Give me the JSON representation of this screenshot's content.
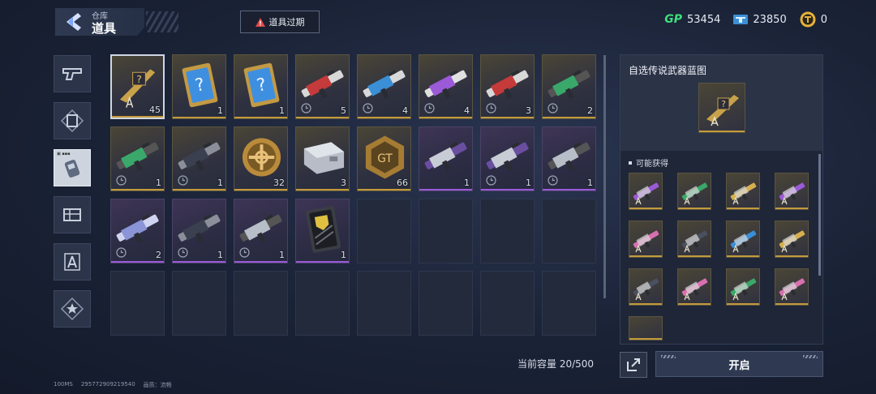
{
  "header": {
    "crumb_parent": "仓库",
    "crumb_current": "道具",
    "expired_label": "道具过期",
    "gp_label": "GP",
    "gp_value": "53454",
    "ticket_value": "23850",
    "coin_value": "0"
  },
  "tabs": [
    {
      "icon": "pistol-icon"
    },
    {
      "icon": "frame-icon"
    },
    {
      "icon": "pager-icon",
      "active": true
    },
    {
      "icon": "gear-crate-icon"
    },
    {
      "icon": "blueprint-icon"
    },
    {
      "icon": "star-badge-icon"
    }
  ],
  "grid": {
    "items": [
      {
        "kind": "blueprint",
        "rarity": "gold",
        "qty": "45",
        "selected": true
      },
      {
        "kind": "mystery-card",
        "rarity": "gold",
        "qty": "1"
      },
      {
        "kind": "mystery-card",
        "rarity": "gold",
        "qty": "1"
      },
      {
        "kind": "rifle-red",
        "rarity": "gold",
        "qty": "5",
        "timed": true
      },
      {
        "kind": "rifle-blue",
        "rarity": "gold",
        "qty": "4",
        "timed": true
      },
      {
        "kind": "rifle-purple",
        "rarity": "gold",
        "qty": "4",
        "timed": true
      },
      {
        "kind": "rifle-red",
        "rarity": "gold",
        "qty": "3",
        "timed": true
      },
      {
        "kind": "rifle-green",
        "rarity": "gold",
        "qty": "2",
        "timed": true
      },
      {
        "kind": "rifle-green",
        "rarity": "gold",
        "qty": "1",
        "timed": true
      },
      {
        "kind": "rifle-dark",
        "rarity": "gold",
        "qty": "1",
        "timed": true
      },
      {
        "kind": "gold-coin",
        "rarity": "gold",
        "qty": "32"
      },
      {
        "kind": "silver-case",
        "rarity": "gold",
        "qty": "3"
      },
      {
        "kind": "gold-hex",
        "rarity": "gold",
        "qty": "66"
      },
      {
        "kind": "smg-silver",
        "rarity": "purple",
        "qty": "1"
      },
      {
        "kind": "smg-silver",
        "rarity": "purple",
        "qty": "1",
        "timed": true
      },
      {
        "kind": "rifle-silver",
        "rarity": "purple",
        "qty": "1",
        "timed": true
      },
      {
        "kind": "rifle-lightning",
        "rarity": "purple",
        "qty": "2",
        "timed": true
      },
      {
        "kind": "rifle-dark",
        "rarity": "purple",
        "qty": "1",
        "timed": true
      },
      {
        "kind": "rifle-silver",
        "rarity": "purple",
        "qty": "1",
        "timed": true
      },
      {
        "kind": "card-pack",
        "rarity": "purple",
        "qty": "1"
      }
    ],
    "capacity_text": "当前容量 20/500"
  },
  "panel": {
    "title": "自选传说武器蓝图",
    "possible_label": "可能获得",
    "rewards": [
      "purple",
      "green",
      "gold",
      "purple",
      "pink",
      "dark",
      "blue",
      "gold",
      "dark",
      "pink",
      "green",
      "pink"
    ]
  },
  "footer": {
    "open_label": "开启",
    "ping": "100MS",
    "uid": "295772909219540",
    "quality_label": "画质：",
    "quality_value": "流畅"
  },
  "colors": {
    "gold_rarity": "#c49a3c",
    "purple_rarity": "#9b5ad8",
    "gp_green": "#3ee07a"
  }
}
